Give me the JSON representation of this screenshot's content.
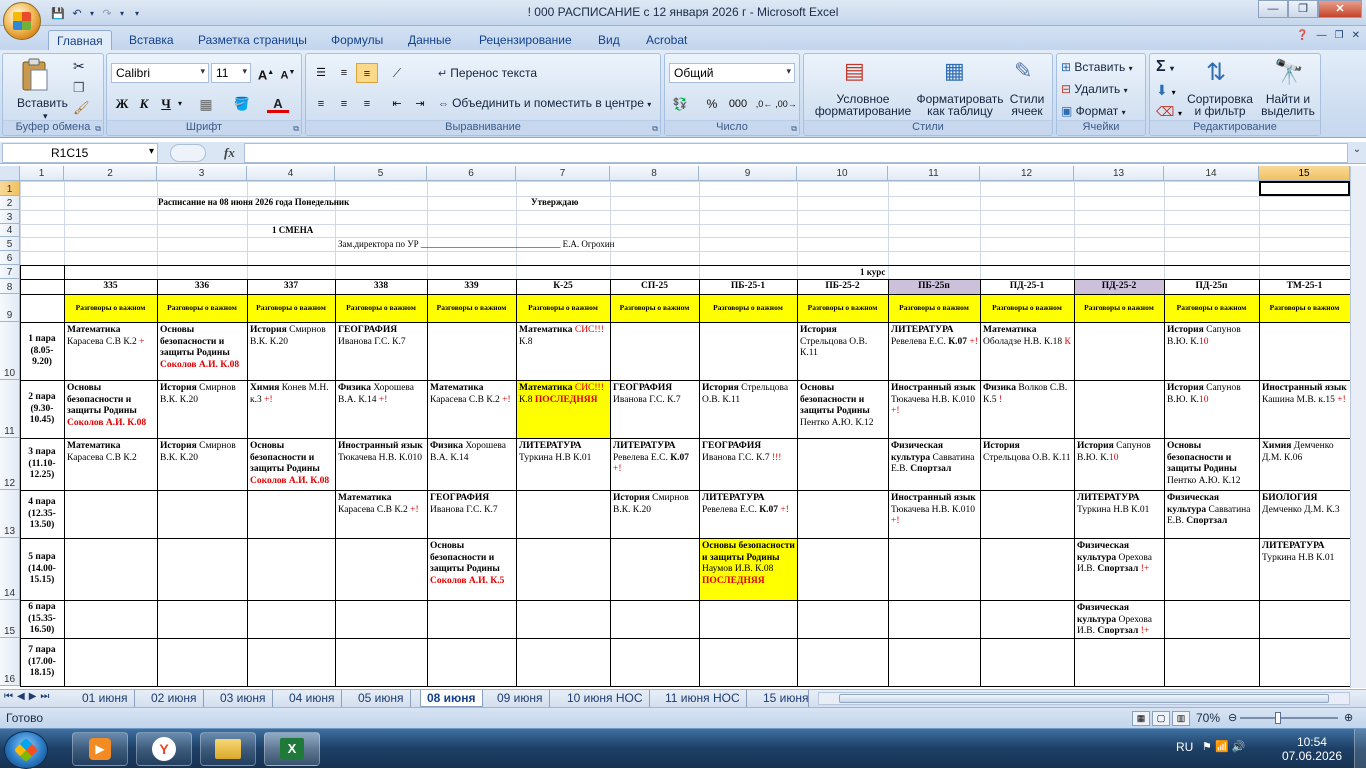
{
  "app": {
    "title": "! 000 РАСПИСАНИЕ с 12 января 2026 г  -  Microsoft Excel"
  },
  "ribbon_tabs": [
    "Главная",
    "Вставка",
    "Разметка страницы",
    "Формулы",
    "Данные",
    "Рецензирование",
    "Вид",
    "Acrobat"
  ],
  "ribbon": {
    "clipboard": {
      "paste": "Вставить",
      "label": "Буфер обмена"
    },
    "font": {
      "name": "Calibri",
      "size": "11",
      "label": "Шрифт",
      "bold": "Ж",
      "italic": "К",
      "underline": "Ч"
    },
    "align": {
      "wrap": "Перенос текста",
      "merge": "Объединить и поместить в центре",
      "label": "Выравнивание"
    },
    "number": {
      "format": "Общий",
      "label": "Число",
      "percent": "%",
      "thousands": "000"
    },
    "styles": {
      "conditional": "Условное форматирование",
      "astable": "Форматировать как таблицу",
      "cellstyles": "Стили ячеек",
      "label": "Стили"
    },
    "cells": {
      "insert": "Вставить",
      "delete": "Удалить",
      "format": "Формат",
      "label": "Ячейки"
    },
    "editing": {
      "sort": "Сортировка и фильтр",
      "find": "Найти и выделить",
      "label": "Редактирование"
    }
  },
  "formula": {
    "namebox": "R1C15",
    "fx": "fx",
    "value": ""
  },
  "columns": [
    "1",
    "2",
    "3",
    "4",
    "5",
    "6",
    "7",
    "8",
    "9",
    "10",
    "11",
    "12",
    "13",
    "14",
    "15"
  ],
  "rows": [
    "1",
    "2",
    "3",
    "4",
    "5",
    "6",
    "7",
    "8",
    "9",
    "10",
    "11",
    "12",
    "13",
    "14",
    "15",
    "16"
  ],
  "header": {
    "title": "Расписание на 08 июня 2026 года  Понедельник",
    "approve": "Утверждаю",
    "shift": "1 СМЕНА",
    "deputy": "Зам.директора по УР  _______________________________ Е.А. Огрохин",
    "course": "1 курс"
  },
  "groups": [
    "335",
    "336",
    "337",
    "338",
    "339",
    "К-25",
    "СП-25",
    "ПБ-25-1",
    "ПБ-25-2",
    "ПБ-25п",
    "ПД-25-1",
    "ПД-25-2",
    "ПД-25п",
    "ТМ-25-1"
  ],
  "talks": "Разговоры о важном",
  "pairs": [
    {
      "name": "1 пара",
      "time": "(8.05-9.20)"
    },
    {
      "name": "2 пара",
      "time": "(9.30-10.45)"
    },
    {
      "name": "3 пара",
      "time": "(11.10-12.25)"
    },
    {
      "name": "4 пара",
      "time": "(12.35-13.50)"
    },
    {
      "name": "5 пара",
      "time": "(14.00-15.15)"
    },
    {
      "name": "6 пара",
      "time": "(15.35-16.50)"
    },
    {
      "name": "7 пара",
      "time": "(17.00-18.15)"
    }
  ],
  "lessons": {
    "p1": [
      {
        "c": 0,
        "html": "<b>Математика</b><br>Карасева С.В К.2 <span class='r'>+</span>"
      },
      {
        "c": 1,
        "html": "<b>Основы безопасности и защиты Родины</b><br><span class='r'><b>Соколов А.И. К.08</b></span>"
      },
      {
        "c": 2,
        "html": "<b>История</b> Смирнов В.К. К.20"
      },
      {
        "c": 3,
        "html": "<b>ГЕОГРАФИЯ</b><br>Иванова Г.С. К.7"
      },
      {
        "c": 5,
        "html": "<b>Математика</b> <span class='r'>СИС!!!</span><br>К.8"
      },
      {
        "c": 8,
        "html": "<b>История</b><br>Стрельцова О.В. К.11"
      },
      {
        "c": 9,
        "html": "<b>ЛИТЕРАТУРА</b><br>Ревелева Е.С. <b>К.07</b> <span class='r'>+!</span>"
      },
      {
        "c": 10,
        "html": "<b>Математика</b><br>Оболадзе Н.В. К.18 <span class='r'>К</span>"
      },
      {
        "c": 12,
        "html": "<b>История</b> Сапунов В.Ю. К.<span class='r'>10</span>"
      }
    ],
    "p2": [
      {
        "c": 0,
        "html": "<b>Основы безопасности и защиты Родины</b><br><span class='r'><b>Соколов А.И. К.08</b></span>"
      },
      {
        "c": 1,
        "html": "<b>История</b> Смирнов В.К. К.20"
      },
      {
        "c": 2,
        "html": "<b>Химия</b> Конев М.Н. к.3 <span class='r'>+!</span>"
      },
      {
        "c": 3,
        "html": "<b>Физика</b> Хорошева В.А. К.14 <span class='r'>+!</span>"
      },
      {
        "c": 4,
        "html": "<b>Математика</b><br>Карасева С.В К.2 <span class='r'>+!</span>"
      },
      {
        "c": 5,
        "y": true,
        "html": "<b>Математика</b> <span class='r'>СИС!!!</span><br>К.8 <span class='r'><b>ПОСЛЕДНЯЯ</b></span>"
      },
      {
        "c": 6,
        "html": "<b>ГЕОГРАФИЯ</b><br>Иванова Г.С. К.7"
      },
      {
        "c": 7,
        "html": "<b>История</b> Стрельцова О.В. К.11"
      },
      {
        "c": 8,
        "html": "<b>Основы безопасности и защиты Родины</b><br>Пентко А.Ю. К.12"
      },
      {
        "c": 9,
        "html": "<b>Иностранный язык</b> Тюкачева Н.В. К.010 <span class='r'>+!</span>"
      },
      {
        "c": 10,
        "html": "<b>Физика</b>  Волков С.В. К.5 <span class='r'>!</span>"
      },
      {
        "c": 12,
        "html": "<b>История</b> Сапунов В.Ю. К.<span class='r'>10</span>"
      },
      {
        "c": 13,
        "html": "<b>Иностранный язык</b> Кашина М.В. к.15 <span class='r'>+!</span>"
      }
    ],
    "p3": [
      {
        "c": 0,
        "html": "<b>Математика</b><br>Карасева С.В К.2"
      },
      {
        "c": 1,
        "html": "<b>История</b> Смирнов В.К. К.20"
      },
      {
        "c": 2,
        "html": "<b>Основы безопасности и защиты Родины</b><br><span class='r'><b>Соколов А.И. К.08</b></span>"
      },
      {
        "c": 3,
        "html": "<b>Иностранный язык</b> Тюкачева Н.В. К.010"
      },
      {
        "c": 4,
        "html": "<b>Физика</b> Хорошева В.А. К.14"
      },
      {
        "c": 5,
        "html": "<b>ЛИТЕРАТУРА</b><br>Туркина Н.В К.01"
      },
      {
        "c": 6,
        "html": "<b>ЛИТЕРАТУРА</b><br>Ревелева Е.С. <b>К.07</b><br><span class='r'>+!</span>"
      },
      {
        "c": 7,
        "html": "<b>ГЕОГРАФИЯ</b> Иванова Г.С. К.7 <span class='r'>!!!</span>"
      },
      {
        "c": 9,
        "html": "<b>Физическая культура</b> Савватина Е.В. <b>Спортзал</b>"
      },
      {
        "c": 10,
        "html": "<b>История</b><br>Стрельцова О.В. К.11"
      },
      {
        "c": 11,
        "html": "<b>История</b> Сапунов В.Ю. К.<span class='r'>10</span>"
      },
      {
        "c": 12,
        "html": "<b>Основы безопасности и защиты Родины</b><br>Пентко А.Ю. К.12"
      },
      {
        "c": 13,
        "html": "<b>Химия</b> Демченко Д.М. К.06"
      }
    ],
    "p4": [
      {
        "c": 3,
        "html": "<b>Математика</b><br>Карасева С.В К.2 <span class='r'>+!</span>"
      },
      {
        "c": 4,
        "html": "<b>ГЕОГРАФИЯ</b><br>Иванова Г.С. К.7"
      },
      {
        "c": 6,
        "html": "<b>История</b> Смирнов В.К. К.20"
      },
      {
        "c": 7,
        "html": "<b>ЛИТЕРАТУРА</b><br>Ревелева Е.С. <b>К.07</b> <span class='r'>+!</span>"
      },
      {
        "c": 9,
        "html": "<b>Иностранный язык</b> Тюкачева Н.В. К.010 <span class='r'>+!</span>"
      },
      {
        "c": 11,
        "html": "<b>ЛИТЕРАТУРА</b><br>Туркина Н.В К.01"
      },
      {
        "c": 12,
        "html": "<b>Физическая культура</b> Савватина Е.В. <b>Спортзал</b>"
      },
      {
        "c": 13,
        "html": "<b>БИОЛОГИЯ</b><br>Демченко Д.М. К.3"
      }
    ],
    "p5": [
      {
        "c": 4,
        "html": "<b>Основы безопасности и защиты Родины</b><br><span class='r'><b>Соколов А.И. К.5</b></span>"
      },
      {
        "c": 7,
        "y": true,
        "html": "<b>Основы безопасности  и защиты Родины</b><br>Наумов И.В. К.08<br><span class='r'><b>ПОСЛЕДНЯЯ</b></span>"
      },
      {
        "c": 11,
        "html": "<b>Физическая культура</b> Орехова И.В. <b>Спортзал</b> <span class='r'>!+</span>"
      },
      {
        "c": 13,
        "html": "<b>ЛИТЕРАТУРА</b><br>Туркина Н.В К.01"
      }
    ],
    "p6": [
      {
        "c": 11,
        "html": "<b>Физическая культура</b> Орехова И.В. <b>Спортзал</b> <span class='r'>!+</span>"
      }
    ],
    "p7": []
  },
  "sheet_tabs": [
    "01 июня",
    "02 июня",
    "03 июня",
    "04 июня",
    "05 июня",
    "08 июня",
    "09 июня",
    "10 июня НОС",
    "11 июня НОС",
    "15 июня"
  ],
  "active_tab": "08 июня",
  "status": {
    "ready": "Готово",
    "zoom": "70%"
  },
  "tray": {
    "lang": "RU",
    "time": "10:54",
    "date": "07.06.2026"
  },
  "colors": {
    "yellow": "#ffff00",
    "lavender": "#ccc0da",
    "red": "#e00000",
    "accent": "#15428b"
  }
}
